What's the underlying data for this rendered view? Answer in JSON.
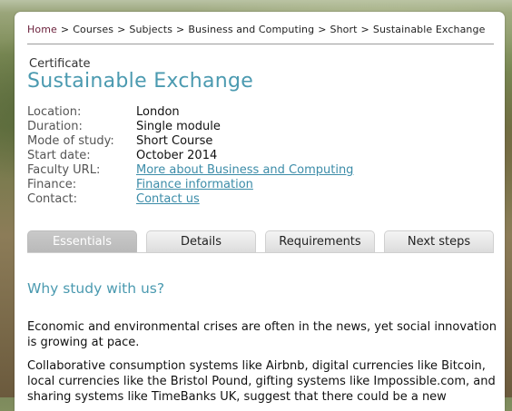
{
  "breadcrumb": {
    "items": [
      "Home",
      "Courses",
      "Subjects",
      "Business and Computing",
      "Short",
      "Sustainable Exchange"
    ],
    "separator": ">"
  },
  "course": {
    "type": "Certificate",
    "title": "Sustainable Exchange"
  },
  "details": [
    {
      "label": "Location:",
      "value": "London"
    },
    {
      "label": "Duration:",
      "value": "Single module"
    },
    {
      "label": "Mode of study:",
      "value": "Short Course"
    },
    {
      "label": "Start date:",
      "value": "October 2014"
    },
    {
      "label": "Faculty URL:",
      "value": "More about Business and Computing"
    },
    {
      "label": "Finance:",
      "value": "Finance information"
    },
    {
      "label": "Contact:",
      "value": "Contact us"
    }
  ],
  "tabs": [
    {
      "label": "Essentials",
      "active": true
    },
    {
      "label": "Details",
      "active": false
    },
    {
      "label": "Requirements",
      "active": false
    },
    {
      "label": "Next steps",
      "active": false
    }
  ],
  "content": {
    "heading": "Why study with us?",
    "paragraph1": "Economic and environmental crises are often in the news, yet social innovation is growing at pace.",
    "paragraph2": "Collaborative consumption systems like Airbnb, digital currencies like Bitcoin, local currencies like the Bristol Pound, gifting systems like Impossible.com, and sharing systems like TimeBanks UK, suggest that there could be a new"
  },
  "colors": {
    "accent": "#4b9ab0",
    "link": "#3c8ca8",
    "home_link": "#6a1f3a"
  }
}
